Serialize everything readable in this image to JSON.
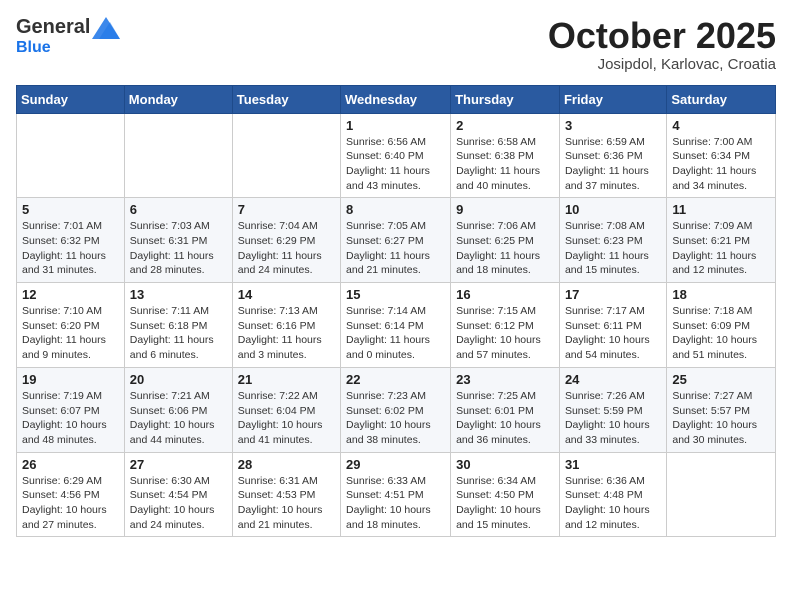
{
  "logo": {
    "general": "General",
    "blue": "Blue"
  },
  "header": {
    "month": "October 2025",
    "location": "Josipdol, Karlovac, Croatia"
  },
  "weekdays": [
    "Sunday",
    "Monday",
    "Tuesday",
    "Wednesday",
    "Thursday",
    "Friday",
    "Saturday"
  ],
  "weeks": [
    [
      {
        "day": "",
        "info": ""
      },
      {
        "day": "",
        "info": ""
      },
      {
        "day": "",
        "info": ""
      },
      {
        "day": "1",
        "info": "Sunrise: 6:56 AM\nSunset: 6:40 PM\nDaylight: 11 hours\nand 43 minutes."
      },
      {
        "day": "2",
        "info": "Sunrise: 6:58 AM\nSunset: 6:38 PM\nDaylight: 11 hours\nand 40 minutes."
      },
      {
        "day": "3",
        "info": "Sunrise: 6:59 AM\nSunset: 6:36 PM\nDaylight: 11 hours\nand 37 minutes."
      },
      {
        "day": "4",
        "info": "Sunrise: 7:00 AM\nSunset: 6:34 PM\nDaylight: 11 hours\nand 34 minutes."
      }
    ],
    [
      {
        "day": "5",
        "info": "Sunrise: 7:01 AM\nSunset: 6:32 PM\nDaylight: 11 hours\nand 31 minutes."
      },
      {
        "day": "6",
        "info": "Sunrise: 7:03 AM\nSunset: 6:31 PM\nDaylight: 11 hours\nand 28 minutes."
      },
      {
        "day": "7",
        "info": "Sunrise: 7:04 AM\nSunset: 6:29 PM\nDaylight: 11 hours\nand 24 minutes."
      },
      {
        "day": "8",
        "info": "Sunrise: 7:05 AM\nSunset: 6:27 PM\nDaylight: 11 hours\nand 21 minutes."
      },
      {
        "day": "9",
        "info": "Sunrise: 7:06 AM\nSunset: 6:25 PM\nDaylight: 11 hours\nand 18 minutes."
      },
      {
        "day": "10",
        "info": "Sunrise: 7:08 AM\nSunset: 6:23 PM\nDaylight: 11 hours\nand 15 minutes."
      },
      {
        "day": "11",
        "info": "Sunrise: 7:09 AM\nSunset: 6:21 PM\nDaylight: 11 hours\nand 12 minutes."
      }
    ],
    [
      {
        "day": "12",
        "info": "Sunrise: 7:10 AM\nSunset: 6:20 PM\nDaylight: 11 hours\nand 9 minutes."
      },
      {
        "day": "13",
        "info": "Sunrise: 7:11 AM\nSunset: 6:18 PM\nDaylight: 11 hours\nand 6 minutes."
      },
      {
        "day": "14",
        "info": "Sunrise: 7:13 AM\nSunset: 6:16 PM\nDaylight: 11 hours\nand 3 minutes."
      },
      {
        "day": "15",
        "info": "Sunrise: 7:14 AM\nSunset: 6:14 PM\nDaylight: 11 hours\nand 0 minutes."
      },
      {
        "day": "16",
        "info": "Sunrise: 7:15 AM\nSunset: 6:12 PM\nDaylight: 10 hours\nand 57 minutes."
      },
      {
        "day": "17",
        "info": "Sunrise: 7:17 AM\nSunset: 6:11 PM\nDaylight: 10 hours\nand 54 minutes."
      },
      {
        "day": "18",
        "info": "Sunrise: 7:18 AM\nSunset: 6:09 PM\nDaylight: 10 hours\nand 51 minutes."
      }
    ],
    [
      {
        "day": "19",
        "info": "Sunrise: 7:19 AM\nSunset: 6:07 PM\nDaylight: 10 hours\nand 48 minutes."
      },
      {
        "day": "20",
        "info": "Sunrise: 7:21 AM\nSunset: 6:06 PM\nDaylight: 10 hours\nand 44 minutes."
      },
      {
        "day": "21",
        "info": "Sunrise: 7:22 AM\nSunset: 6:04 PM\nDaylight: 10 hours\nand 41 minutes."
      },
      {
        "day": "22",
        "info": "Sunrise: 7:23 AM\nSunset: 6:02 PM\nDaylight: 10 hours\nand 38 minutes."
      },
      {
        "day": "23",
        "info": "Sunrise: 7:25 AM\nSunset: 6:01 PM\nDaylight: 10 hours\nand 36 minutes."
      },
      {
        "day": "24",
        "info": "Sunrise: 7:26 AM\nSunset: 5:59 PM\nDaylight: 10 hours\nand 33 minutes."
      },
      {
        "day": "25",
        "info": "Sunrise: 7:27 AM\nSunset: 5:57 PM\nDaylight: 10 hours\nand 30 minutes."
      }
    ],
    [
      {
        "day": "26",
        "info": "Sunrise: 6:29 AM\nSunset: 4:56 PM\nDaylight: 10 hours\nand 27 minutes."
      },
      {
        "day": "27",
        "info": "Sunrise: 6:30 AM\nSunset: 4:54 PM\nDaylight: 10 hours\nand 24 minutes."
      },
      {
        "day": "28",
        "info": "Sunrise: 6:31 AM\nSunset: 4:53 PM\nDaylight: 10 hours\nand 21 minutes."
      },
      {
        "day": "29",
        "info": "Sunrise: 6:33 AM\nSunset: 4:51 PM\nDaylight: 10 hours\nand 18 minutes."
      },
      {
        "day": "30",
        "info": "Sunrise: 6:34 AM\nSunset: 4:50 PM\nDaylight: 10 hours\nand 15 minutes."
      },
      {
        "day": "31",
        "info": "Sunrise: 6:36 AM\nSunset: 4:48 PM\nDaylight: 10 hours\nand 12 minutes."
      },
      {
        "day": "",
        "info": ""
      }
    ]
  ]
}
